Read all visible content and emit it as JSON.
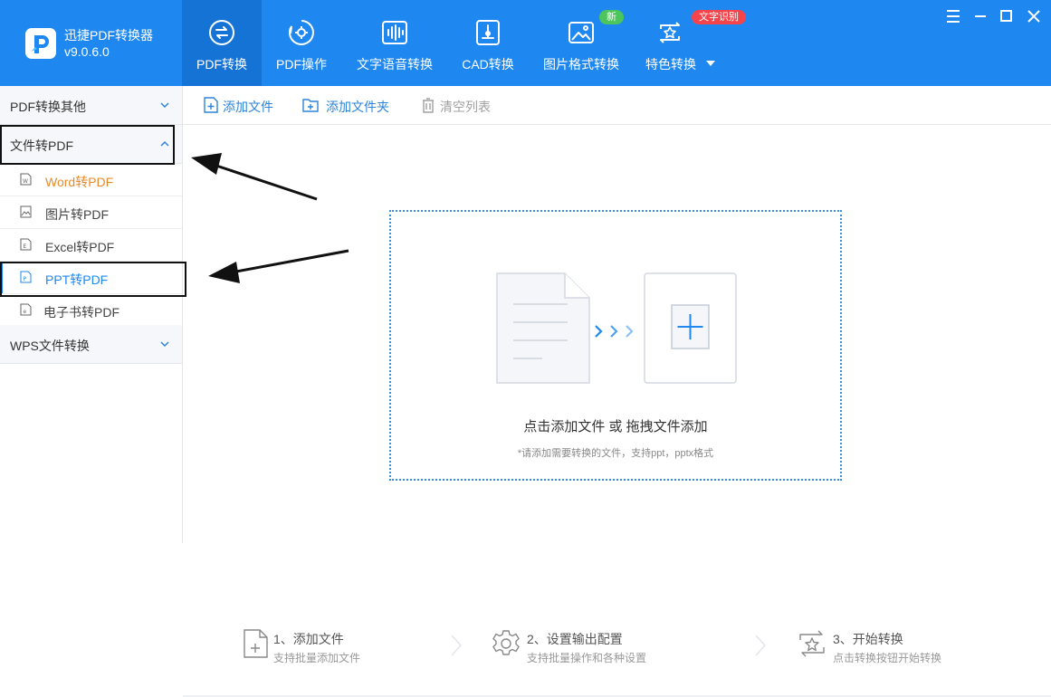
{
  "app": {
    "name": "迅捷PDF转换器",
    "version": "v9.0.6.0"
  },
  "nav": {
    "tabs": [
      {
        "label": "PDF转换",
        "icon": "pdf-convert-icon",
        "active": true
      },
      {
        "label": "PDF操作",
        "icon": "pdf-operation-icon",
        "active": false
      },
      {
        "label": "文字语音转换",
        "icon": "audio-wave-icon",
        "active": false
      },
      {
        "label": "CAD转换",
        "icon": "cad-icon",
        "active": false
      },
      {
        "label": "图片格式转换",
        "icon": "image-icon",
        "active": false
      },
      {
        "label": "特色转换",
        "icon": "special-convert-icon",
        "active": false,
        "has_dropdown": true
      }
    ],
    "badges": {
      "new": "新",
      "ocr": "文字识别"
    }
  },
  "window_controls": [
    "menu-icon",
    "minimize-icon",
    "maximize-icon",
    "close-icon"
  ],
  "sidebar": {
    "categories": [
      {
        "label": "PDF转换其他",
        "expanded": false
      },
      {
        "label": "文件转PDF",
        "expanded": true
      },
      {
        "label": "WPS文件转换",
        "expanded": false
      }
    ],
    "items": [
      {
        "label": "Word转PDF",
        "icon": "word-file-icon"
      },
      {
        "label": "图片转PDF",
        "icon": "image-file-icon"
      },
      {
        "label": "Excel转PDF",
        "icon": "excel-file-icon"
      },
      {
        "label": "PPT转PDF",
        "icon": "ppt-file-icon",
        "selected": true
      },
      {
        "label": "电子书转PDF",
        "icon": "ebook-file-icon"
      }
    ]
  },
  "toolbar": {
    "add_file": "添加文件",
    "add_folder": "添加文件夹",
    "clear_list": "清空列表"
  },
  "dropzone": {
    "title": "点击添加文件 或 拖拽文件添加",
    "hint": "*请添加需要转换的文件，支持ppt，pptx格式"
  },
  "steps": [
    {
      "title": "1、添加文件",
      "desc": "支持批量添加文件",
      "icon": "add-file-icon"
    },
    {
      "title": "2、设置输出配置",
      "desc": "支持批量操作和各种设置",
      "icon": "settings-gear-icon"
    },
    {
      "title": "3、开始转换",
      "desc": "点击转换按钮开始转换",
      "icon": "convert-star-icon"
    }
  ],
  "colors": {
    "primary": "#1e88f0",
    "active_tab": "#1673d6",
    "accent_orange": "#e88a2a",
    "badge_new": "#4cc55c",
    "badge_ocr": "#f5444b"
  }
}
